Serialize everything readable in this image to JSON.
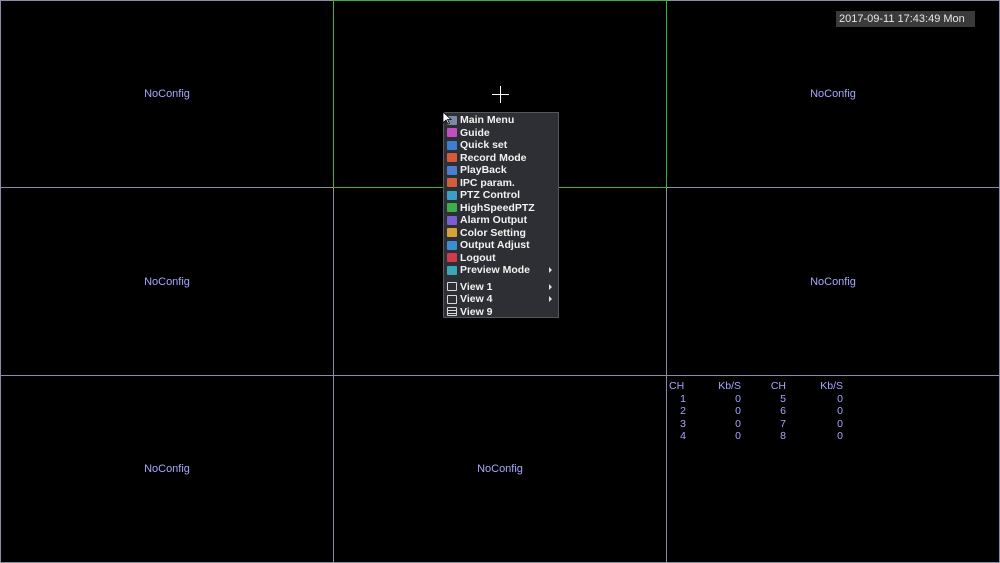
{
  "datetime": "2017-09-11 17:43:49 Mon",
  "channels": [
    {
      "label": "NoConfig"
    },
    {
      "label": ""
    },
    {
      "label": "NoConfig"
    },
    {
      "label": "NoConfig"
    },
    {
      "label": ""
    },
    {
      "label": "NoConfig"
    },
    {
      "label": "NoConfig"
    },
    {
      "label": "NoConfig"
    },
    {
      "label": ""
    }
  ],
  "menu": {
    "items": [
      {
        "label": "Main Menu",
        "icon": "main-menu-icon",
        "color": "#7a8aa6"
      },
      {
        "label": "Guide",
        "icon": "guide-icon",
        "color": "#c24fc2"
      },
      {
        "label": "Quick set",
        "icon": "quick-set-icon",
        "color": "#3c7fcf"
      },
      {
        "label": "Record Mode",
        "icon": "record-mode-icon",
        "color": "#d35a3a"
      },
      {
        "label": "PlayBack",
        "icon": "playback-icon",
        "color": "#4a7fd0"
      },
      {
        "label": "IPC param.",
        "icon": "ipc-param-icon",
        "color": "#d0603a"
      },
      {
        "label": "PTZ Control",
        "icon": "ptz-control-icon",
        "color": "#3aa0c8"
      },
      {
        "label": "HighSpeedPTZ",
        "icon": "highspeed-ptz-icon",
        "color": "#3fae4a"
      },
      {
        "label": "Alarm Output",
        "icon": "alarm-output-icon",
        "color": "#7a5fd0"
      },
      {
        "label": "Color Setting",
        "icon": "color-setting-icon",
        "color": "#d8a23a"
      },
      {
        "label": "Output Adjust",
        "icon": "output-adjust-icon",
        "color": "#3a8fd0"
      },
      {
        "label": "Logout",
        "icon": "logout-icon",
        "color": "#d03a4a"
      },
      {
        "label": "Preview Mode",
        "icon": "preview-mode-icon",
        "color": "#3aa6b8"
      }
    ],
    "views": [
      {
        "label": "View 1",
        "icon": "view-1-icon"
      },
      {
        "label": "View 4",
        "icon": "view-4-icon"
      },
      {
        "label": "View 9",
        "icon": "view-9-icon"
      }
    ]
  },
  "bitrate": {
    "headers": [
      "CH",
      "Kb/S",
      "CH",
      "Kb/S"
    ],
    "rows": [
      [
        "1",
        "0",
        "5",
        "0"
      ],
      [
        "2",
        "0",
        "6",
        "0"
      ],
      [
        "3",
        "0",
        "7",
        "0"
      ],
      [
        "4",
        "0",
        "8",
        "0"
      ]
    ]
  }
}
